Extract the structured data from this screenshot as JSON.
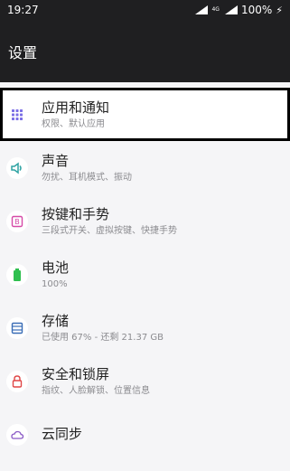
{
  "statusbar": {
    "time": "19:27",
    "network_label": "4G",
    "battery_text": "100%",
    "charging_icon": "bolt"
  },
  "appbar": {
    "title": "设置"
  },
  "items": [
    {
      "title": "应用和通知",
      "subtitle": "权限、默认应用",
      "icon": "apps-grid-icon",
      "icon_color": "#7b6fe6"
    },
    {
      "title": "声音",
      "subtitle": "勿扰、耳机模式、振动",
      "icon": "volume-icon",
      "icon_color": "#2ea3a3"
    },
    {
      "title": "按键和手势",
      "subtitle": "三段式开关、虚拟按键、快捷手势",
      "icon": "key-icon",
      "icon_color": "#d64aa7"
    },
    {
      "title": "电池",
      "subtitle": "100%",
      "icon": "battery-icon",
      "icon_color": "#2fbf4f"
    },
    {
      "title": "存储",
      "subtitle": "已使用 67% - 还剩 21.37 GB",
      "icon": "storage-icon",
      "icon_color": "#3a6db6"
    },
    {
      "title": "安全和锁屏",
      "subtitle": "指纹、人脸解锁、位置信息",
      "icon": "lock-icon",
      "icon_color": "#e04747"
    },
    {
      "title": "云同步",
      "subtitle": "",
      "icon": "cloud-icon",
      "icon_color": "#8a59c6"
    }
  ]
}
